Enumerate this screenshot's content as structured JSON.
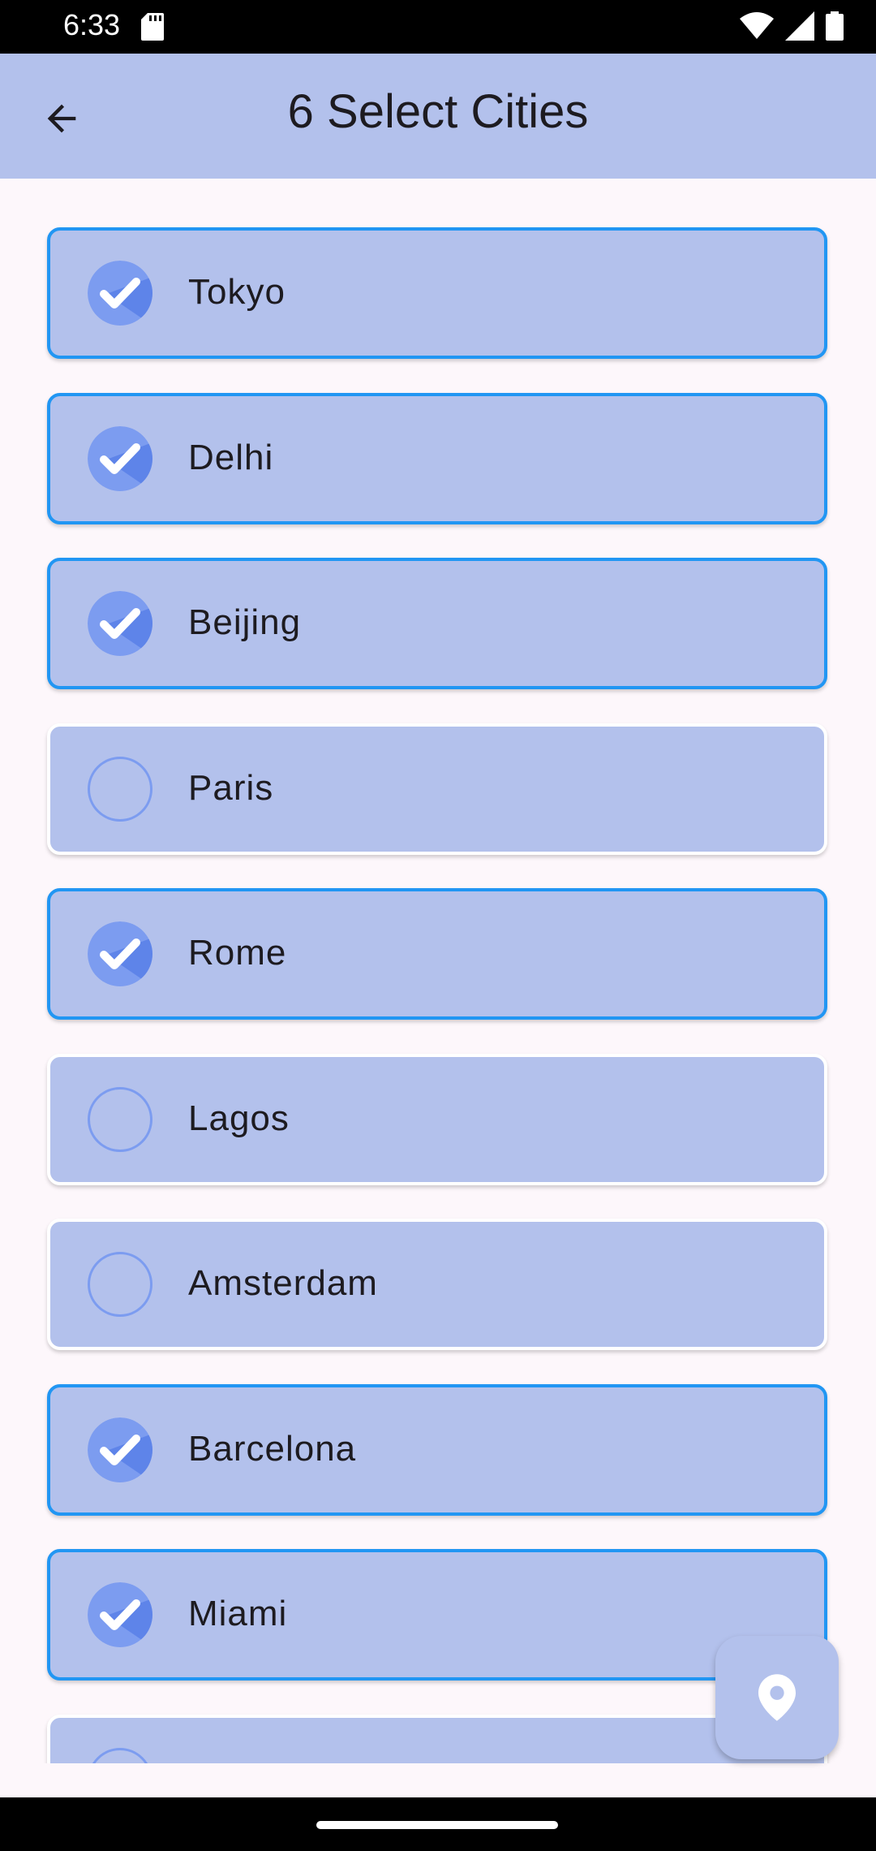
{
  "status_bar": {
    "time": "6:33",
    "icons": [
      "sd-card-icon",
      "wifi-icon",
      "signal-icon",
      "battery-icon"
    ]
  },
  "app_bar": {
    "title": "6 Select Cities",
    "back_icon": "arrow-back-icon"
  },
  "cities": [
    {
      "name": "Tokyo",
      "selected": true
    },
    {
      "name": "Delhi",
      "selected": true
    },
    {
      "name": "Beijing",
      "selected": true
    },
    {
      "name": "Paris",
      "selected": false
    },
    {
      "name": "Rome",
      "selected": true
    },
    {
      "name": "Lagos",
      "selected": false
    },
    {
      "name": "Amsterdam",
      "selected": false
    },
    {
      "name": "Barcelona",
      "selected": true
    },
    {
      "name": "Miami",
      "selected": true
    },
    {
      "name": "",
      "selected": false
    }
  ],
  "fab": {
    "icon": "location-pin-icon"
  },
  "colors": {
    "app_bar": "#b3c1ec",
    "card": "#b3c1ec",
    "selected_border": "#2196f3",
    "check_fill": "#7c9cf0",
    "check_shadow": "#5b82e8",
    "background": "#fdf7fb"
  }
}
